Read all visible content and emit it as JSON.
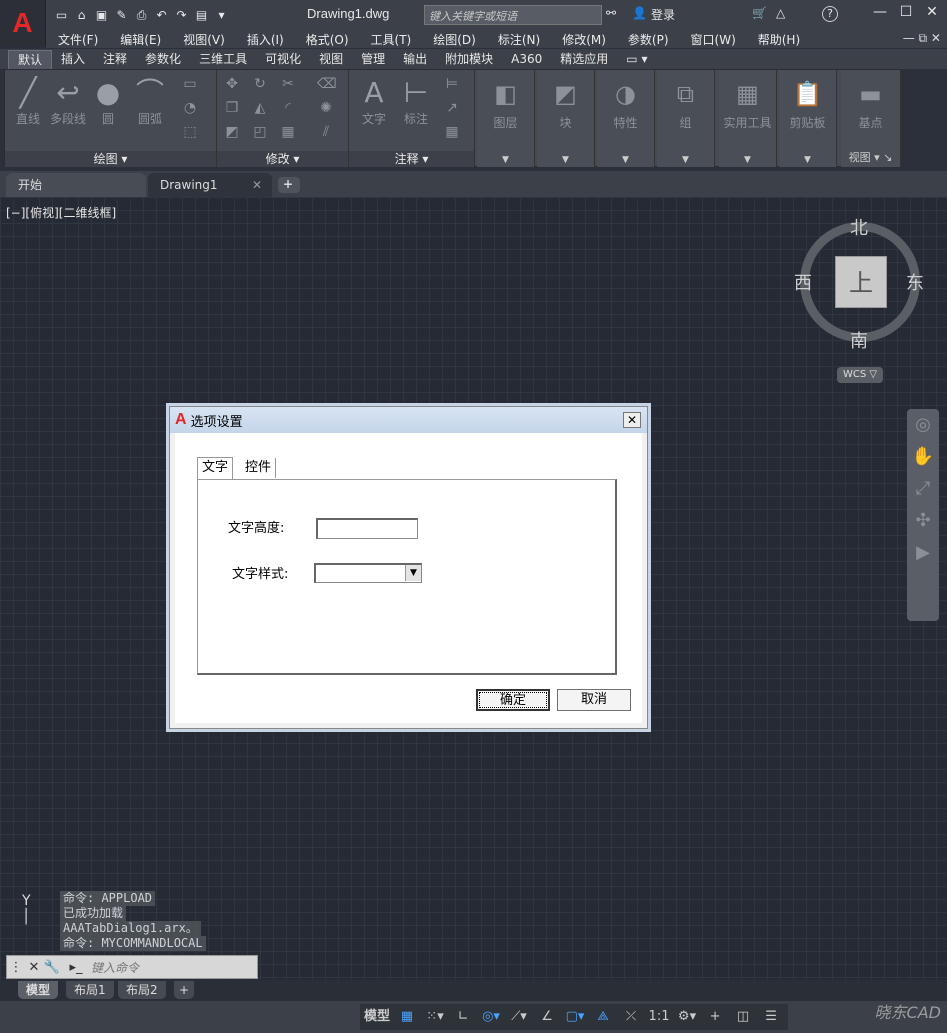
{
  "titlebar": {
    "doc_title": "Drawing1.dwg",
    "search_placeholder": "键入关键字或短语",
    "login": "登录",
    "help": "?"
  },
  "menubar": [
    "文件(F)",
    "编辑(E)",
    "视图(V)",
    "插入(I)",
    "格式(O)",
    "工具(T)",
    "绘图(D)",
    "标注(N)",
    "修改(M)",
    "参数(P)",
    "窗口(W)",
    "帮助(H)"
  ],
  "ribbon_tabs": [
    "默认",
    "插入",
    "注释",
    "参数化",
    "三维工具",
    "可视化",
    "视图",
    "管理",
    "输出",
    "附加模块",
    "A360",
    "精选应用"
  ],
  "ribbon": {
    "draw_panel": "绘图",
    "modify_panel": "修改",
    "annotate_panel": "注释",
    "view_panel": "视图",
    "tools": {
      "line": "直线",
      "polyline": "多段线",
      "circle": "圆",
      "arc": "圆弧",
      "text": "文字",
      "dimension": "标注",
      "layers": "图层",
      "block": "块",
      "properties": "特性",
      "group": "组",
      "utilities": "实用工具",
      "clipboard": "剪贴板",
      "base": "基点"
    }
  },
  "doc_tabs": {
    "start": "开始",
    "drawing": "Drawing1",
    "close": "✕",
    "add": "+"
  },
  "viewport_label": "[−][俯视][二维线框]",
  "viewcube": {
    "north": "北",
    "south": "南",
    "east": "东",
    "west": "西",
    "face": "上",
    "wcs": "WCS ▽"
  },
  "dialog": {
    "title": "选项设置",
    "close": "✕",
    "tabs": [
      "文字",
      "控件"
    ],
    "text_height_label": "文字高度:",
    "text_height_value": "",
    "text_style_label": "文字样式:",
    "text_style_value": "",
    "ok": "确定",
    "cancel": "取消"
  },
  "command": {
    "history": [
      "命令: APPLOAD",
      "已成功加载",
      "AAATabDialog1.arx。",
      "命令: MYCOMMANDLOCAL"
    ],
    "placeholder": "键入命令"
  },
  "layout_tabs": [
    "模型",
    "布局1",
    "布局2",
    "+"
  ],
  "status": {
    "model": "模型",
    "scale": "1:1"
  },
  "watermark": "晓东CAD"
}
